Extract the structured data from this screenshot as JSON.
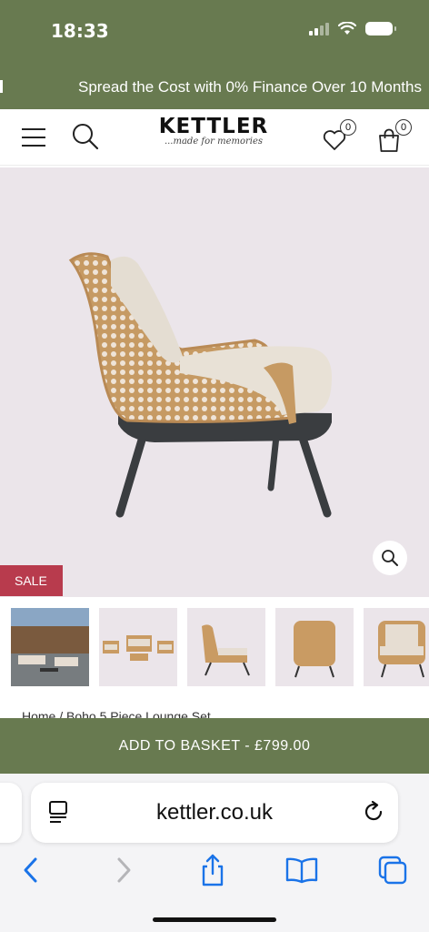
{
  "status_bar": {
    "time": "18:33",
    "icons": [
      "cellular-signal-icon",
      "wifi-icon",
      "battery-icon"
    ]
  },
  "promo": {
    "text": "Spread the Cost with 0% Finance Over 10 Months"
  },
  "header": {
    "brand": "KETTLER",
    "tagline": "...made for memories",
    "wishlist_count": "0",
    "basket_count": "0",
    "icons": [
      "menu-icon",
      "search-icon",
      "heart-icon",
      "shopping-bag-icon"
    ]
  },
  "product": {
    "badge": "SALE",
    "image_alt": "Boho lounge chair side view",
    "zoom_icon": "magnifier-icon",
    "thumbnails": [
      "garden-set-scene",
      "lounge-set-front",
      "chair-side",
      "chair-back",
      "chair-front"
    ]
  },
  "breadcrumb": {
    "text": "Home / Boho 5 Piece Lounge Set"
  },
  "cta": {
    "label": "ADD TO BASKET - £799.00"
  },
  "browser": {
    "url": "kettler.co.uk",
    "icons": [
      "reader-icon",
      "reload-icon",
      "back-icon",
      "forward-icon",
      "share-icon",
      "bookmarks-icon",
      "tabs-icon"
    ]
  },
  "colors": {
    "brand_green": "#687a50",
    "sale_red": "#b83b4d",
    "product_bg": "#ebe5ea",
    "safari_blue": "#1a73e8"
  }
}
